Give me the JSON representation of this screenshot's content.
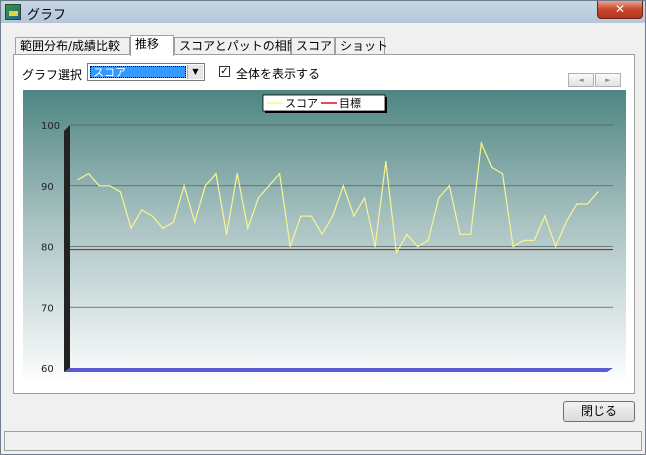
{
  "window": {
    "title": "グラフ",
    "close_label": "✕"
  },
  "tabs": [
    {
      "label": "範囲分布/成績比較",
      "active": false
    },
    {
      "label": "推移",
      "active": true
    },
    {
      "label": "スコアとパットの相関",
      "active": false
    },
    {
      "label": "スコア",
      "active": false
    },
    {
      "label": "ショット",
      "active": false
    }
  ],
  "controls": {
    "graph_select_label": "グラフ選択",
    "graph_select_value": "スコア",
    "show_all_checked": true,
    "show_all_label": "全体を表示する",
    "scroll_left": "◄",
    "scroll_right": "►"
  },
  "chart_data": {
    "type": "line",
    "y_ticks": [
      "100",
      "90",
      "80",
      "70",
      "60"
    ],
    "ylim": [
      60,
      100
    ],
    "grid": true,
    "legend": "top-center",
    "colors": {
      "score": "#f6f690",
      "target": "#e01010"
    },
    "series": [
      {
        "name": "スコア",
        "values": [
          91,
          92,
          90,
          90,
          89,
          83,
          86,
          85,
          83,
          84,
          90,
          84,
          90,
          92,
          82,
          92,
          83,
          88,
          90,
          92,
          80,
          85,
          85,
          82,
          85,
          90,
          85,
          88,
          80,
          94,
          79,
          82,
          80,
          81,
          88,
          90,
          82,
          82,
          97,
          93,
          92,
          80,
          81,
          81,
          85,
          80,
          84,
          87,
          87,
          89
        ]
      },
      {
        "name": "目標",
        "value": 79.5
      }
    ]
  },
  "footer": {
    "close_button": "閉じる"
  }
}
